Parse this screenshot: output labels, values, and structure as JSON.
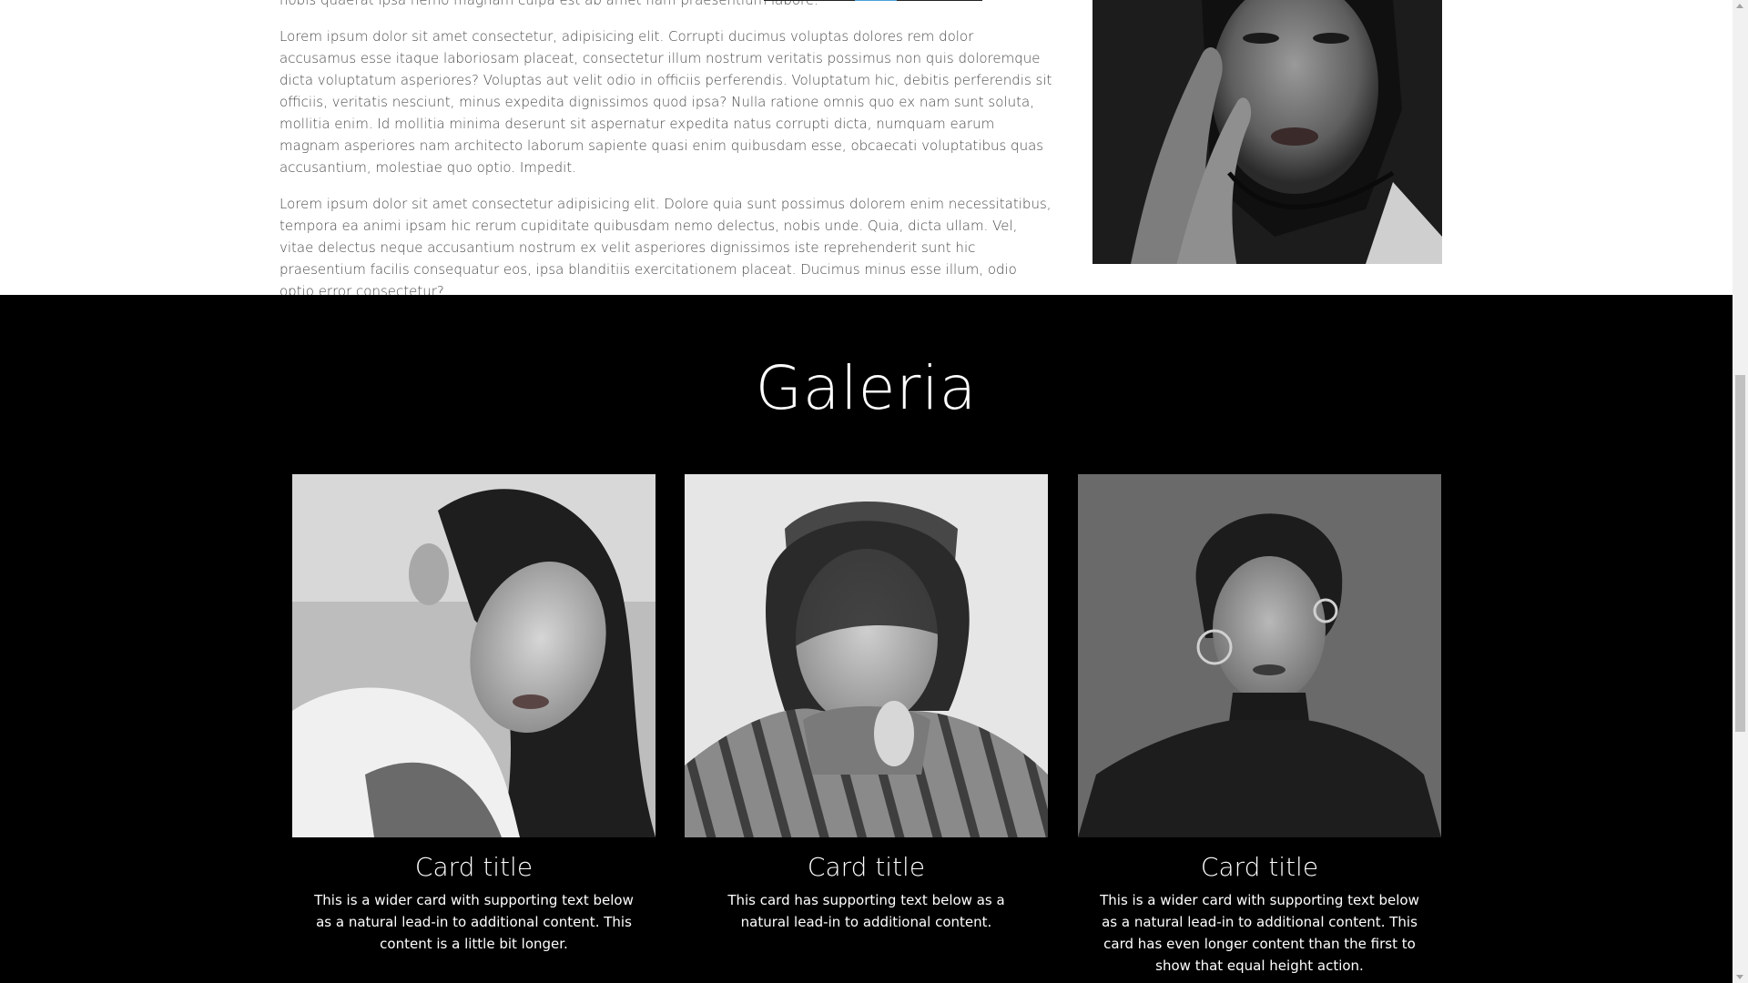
{
  "about": {
    "paragraphs": [
      "nobis quaerat ipsa nemo magnam culpa est ab amet nam praesentium labore.",
      "Lorem ipsum dolor sit amet consectetur, adipisicing elit. Corrupti ducimus voluptas dolores rem dolor accusamus esse itaque laboriosam placeat, consectetur illum nostrum veritatis possimus non quis doloremque dicta voluptatum asperiores? Voluptas aut velit odio in officiis perferendis. Voluptatum hic, debitis perferendis sit officiis, veritatis nesciunt, minus expedita dignissimos quod ipsa? Nulla ratione omnis quo ex nam sunt soluta, mollitia enim. Id mollitia minima deserunt sit aspernatur expedita natus corrupti dicta, numquam earum magnam asperiores nam architecto laborum sapiente quasi enim quibusdam esse, obcaecati voluptatibus quas accusantium, molestiae quo optio. Impedit.",
      "Lorem ipsum dolor sit amet consectetur adipisicing elit. Dolore quia sunt possimus dolorem enim necessitatibus, tempora ea animi ipsam hic rerum cupiditate quibusdam nemo delectus, nobis unde. Quia, dicta ullam. Vel, vitae delectus neque accusantium nostrum ex velit asperiores dignissimos iste reprehenderit sunt hic praesentium facilis consequatur eos, ipsa blanditiis exercitationem placeat. Ducimus minus esse illum, odio optio error consectetur?"
    ]
  },
  "gallery": {
    "title": "Galeria",
    "cards": [
      {
        "title": "Card title",
        "text": "This is a wider card with supporting text below as a natural lead-in to additional content. This content is a little bit longer."
      },
      {
        "title": "Card title",
        "text": "This card has supporting text below as a natural lead-in to additional content."
      },
      {
        "title": "Card title",
        "text": "This is a wider card with supporting text below as a natural lead-in to additional content. This card has even longer content than the first to show that equal height action."
      }
    ]
  },
  "colors": {
    "gallery_background": "#000000",
    "body_text": "#4a4a4a",
    "accent_underline": "#4aa3df"
  }
}
